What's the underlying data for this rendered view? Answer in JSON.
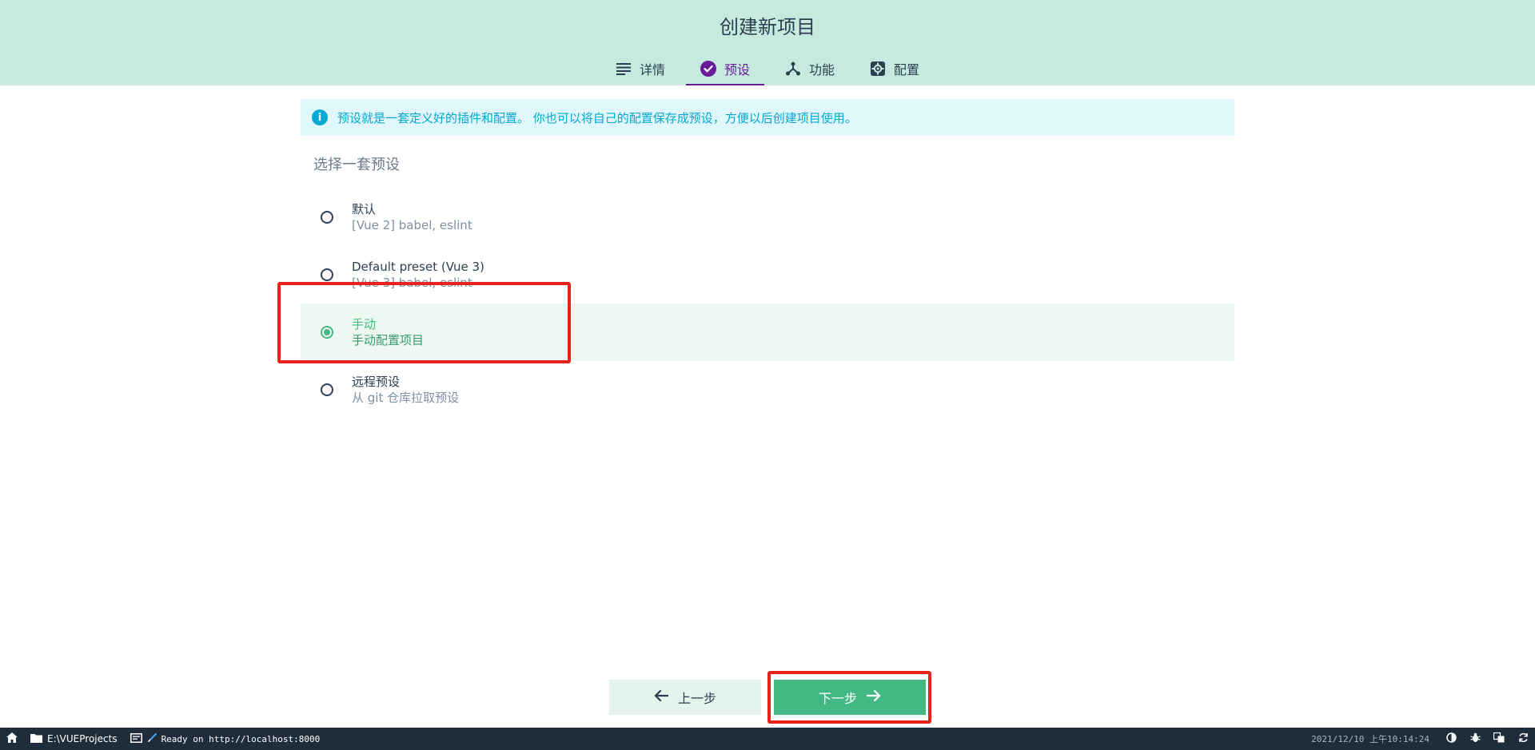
{
  "header": {
    "title": "创建新项目"
  },
  "tabs": [
    {
      "label": "详情",
      "icon": "list-icon",
      "active": false
    },
    {
      "label": "预设",
      "icon": "check-circle-icon",
      "active": true
    },
    {
      "label": "功能",
      "icon": "fork-icon",
      "active": false
    },
    {
      "label": "配置",
      "icon": "gear-icon",
      "active": false
    }
  ],
  "info": {
    "text": "预设就是一套定义好的插件和配置。 你也可以将自己的配置保存成预设，方便以后创建项目使用。",
    "icon_glyph": "i"
  },
  "section": {
    "title": "选择一套预设"
  },
  "presets": [
    {
      "name": "默认",
      "desc": "[Vue 2] babel, eslint",
      "selected": false
    },
    {
      "name": "Default preset (Vue 3)",
      "desc": "[Vue 3] babel, eslint",
      "selected": false
    },
    {
      "name": "手动",
      "desc": "手动配置项目",
      "selected": true
    },
    {
      "name": "远程预设",
      "desc": "从 git 仓库拉取预设",
      "selected": false
    }
  ],
  "buttons": {
    "prev_label": "上一步",
    "next_label": "下一步"
  },
  "statusbar": {
    "folder": "E:\\VUEProjects",
    "status": "Ready on http://localhost:8000",
    "time": "2021/12/10 上午10:14:24"
  },
  "colors": {
    "header_bg": "#c6eade",
    "accent": "#42b983",
    "tab_active": "#6a1b9a",
    "info": "#03a9d4",
    "annotation": "#e8231c",
    "statusbar_bg": "#1f2d3a"
  }
}
